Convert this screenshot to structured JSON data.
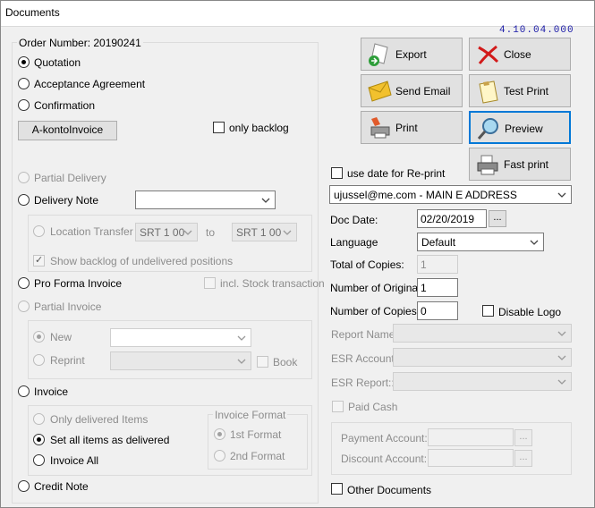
{
  "window": {
    "title": "Documents",
    "version": "4.10.04.000"
  },
  "left": {
    "order_number": "Order Number: 20190241",
    "quotation": "Quotation",
    "acceptance": "Acceptance Agreement",
    "confirmation": "Confirmation",
    "akonto_button": "A-kontoInvoice",
    "only_backlog": "only backlog",
    "partial_delivery": "Partial Delivery",
    "delivery_note": "Delivery Note",
    "delivery_combo": "",
    "location_transfer": "Location Transfer",
    "loc_from": "SRT 1 00",
    "to": "to",
    "loc_to": "SRT 1 00",
    "show_backlog": "Show backlog of undelivered positions",
    "pro_forma": "Pro Forma Invoice",
    "incl_stock": "incl. Stock transaction",
    "partial_invoice": "Partial Invoice",
    "new": "New",
    "reprint": "Reprint",
    "book": "Book",
    "invoice": "Invoice",
    "only_delivered": "Only delivered Items",
    "set_all": "Set all items as delivered",
    "invoice_all": "Invoice All",
    "invoice_format": "Invoice Format",
    "first_format": "1st Format",
    "second_format": "2nd Format",
    "credit_note": "Credit Note"
  },
  "buttons": {
    "export": "Export",
    "close": "Close",
    "send_email": "Send Email",
    "test_print": "Test Print",
    "print": "Print",
    "preview": "Preview",
    "fast_print": "Fast print"
  },
  "right": {
    "use_date": "use date for Re-print",
    "address": "ujussel@me.com - MAIN E ADDRESS",
    "doc_date_label": "Doc Date:",
    "doc_date": "02/20/2019",
    "ellipsis": "...",
    "language_label": "Language",
    "language": "Default",
    "total_copies_label": "Total of Copies:",
    "total_copies": "1",
    "num_original_label": "Number of Original:",
    "num_original": "1",
    "num_copies_label": "Number of Copies:",
    "num_copies": "0",
    "disable_logo": "Disable Logo",
    "report_name_label": "Report Name:",
    "esr_account_label": "ESR Account:",
    "esr_report_label": "ESR Report::",
    "paid_cash": "Paid Cash",
    "payment_account_label": "Payment Account:",
    "discount_account_label": "Discount Account:",
    "other_documents": "Other Documents"
  }
}
